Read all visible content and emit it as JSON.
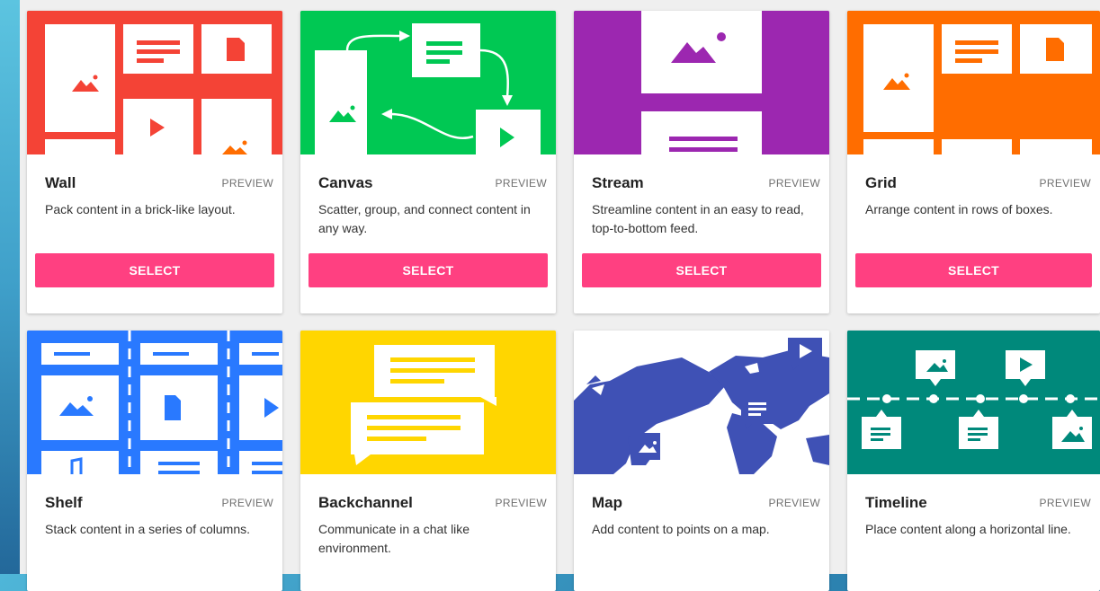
{
  "cards": [
    {
      "title": "Wall",
      "preview": "PREVIEW",
      "desc": "Pack content in a brick-like layout.",
      "select": "SELECT",
      "color": "#f44336"
    },
    {
      "title": "Canvas",
      "preview": "PREVIEW",
      "desc": "Scatter, group, and connect content in any way.",
      "select": "SELECT",
      "color": "#00c853"
    },
    {
      "title": "Stream",
      "preview": "PREVIEW",
      "desc": "Streamline content in an easy to read, top-to-bottom feed.",
      "select": "SELECT",
      "color": "#9c27b0"
    },
    {
      "title": "Grid",
      "preview": "PREVIEW",
      "desc": "Arrange content in rows of boxes.",
      "select": "SELECT",
      "color": "#ff6d00"
    },
    {
      "title": "Shelf",
      "preview": "PREVIEW",
      "desc": "Stack content in a series of columns.",
      "color": "#2979ff"
    },
    {
      "title": "Backchannel",
      "preview": "PREVIEW",
      "desc": "Communicate in a chat like environment.",
      "color": "#ffd600"
    },
    {
      "title": "Map",
      "preview": "PREVIEW",
      "desc": "Add content to points on a map.",
      "color": "#3f51b5"
    },
    {
      "title": "Timeline",
      "preview": "PREVIEW",
      "desc": "Place content along a horizontal line.",
      "color": "#00897b"
    }
  ]
}
